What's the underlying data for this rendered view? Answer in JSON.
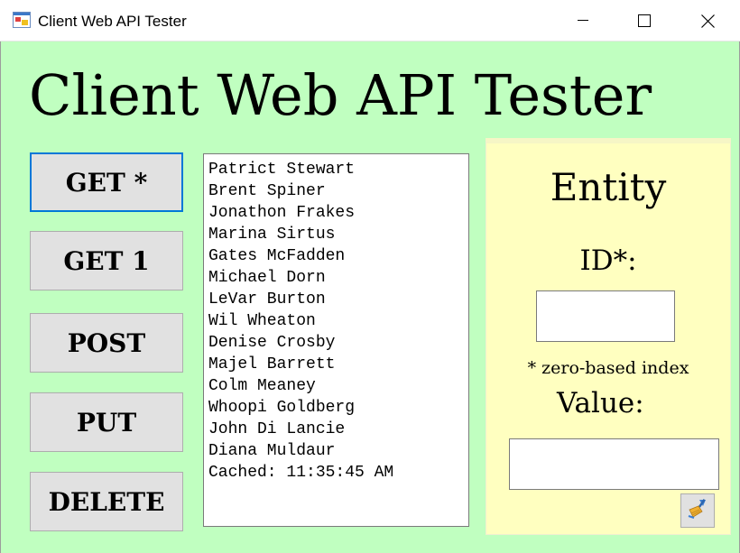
{
  "window": {
    "title": "Client Web API Tester",
    "icon": "app-window-icon",
    "controls": [
      "minimize-icon",
      "maximize-icon",
      "close-icon"
    ]
  },
  "heading": "Client Web API Tester",
  "actions": {
    "get_all": "GET *",
    "get_one": "GET 1",
    "post": "POST",
    "put": "PUT",
    "delete": "DELETE"
  },
  "list": {
    "items": [
      "Patrict Stewart",
      "Brent Spiner",
      "Jonathon Frakes",
      "Marina Sirtus",
      "Gates McFadden",
      "Michael Dorn",
      "LeVar Burton",
      "Wil Wheaton",
      "Denise Crosby",
      "Majel Barrett",
      "Colm Meaney",
      "Whoopi Goldberg",
      "John Di Lancie",
      "Diana Muldaur",
      "Cached: 11:35:45 AM"
    ]
  },
  "entity": {
    "title": "Entity",
    "id_label": "ID*:",
    "id_value": "",
    "id_hint": "* zero-based index",
    "value_label": "Value:",
    "value_value": "",
    "clear_icon": "broom-icon"
  },
  "colors": {
    "background": "#c0ffc0",
    "entity_panel": "#ffffc0",
    "focus_border": "#0078d7"
  }
}
